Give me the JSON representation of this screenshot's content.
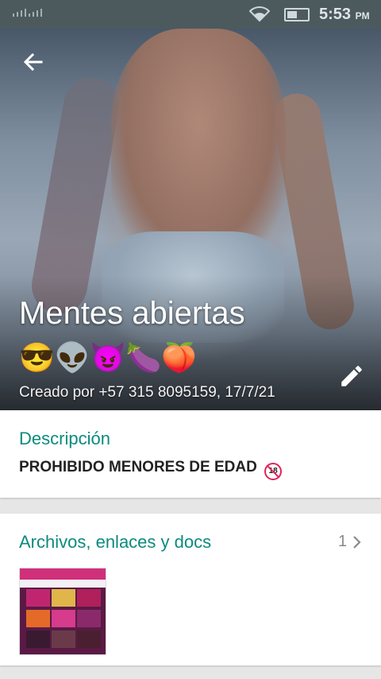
{
  "status_bar": {
    "time": "5:53",
    "ampm": "PM"
  },
  "header": {
    "group_name": "Mentes  abiertas",
    "emojis": "😎👽😈🍆🍑",
    "created_by": "Creado por +57 315 8095159, 17/7/21"
  },
  "description": {
    "title": "Descripción",
    "text": "PROHIBIDO MENORES DE EDAD",
    "badge": "18"
  },
  "media": {
    "title": "Archivos, enlaces y docs",
    "count": "1"
  },
  "colors": {
    "accent": "#0b8b7d",
    "status_bar": "#4c5a5e"
  }
}
